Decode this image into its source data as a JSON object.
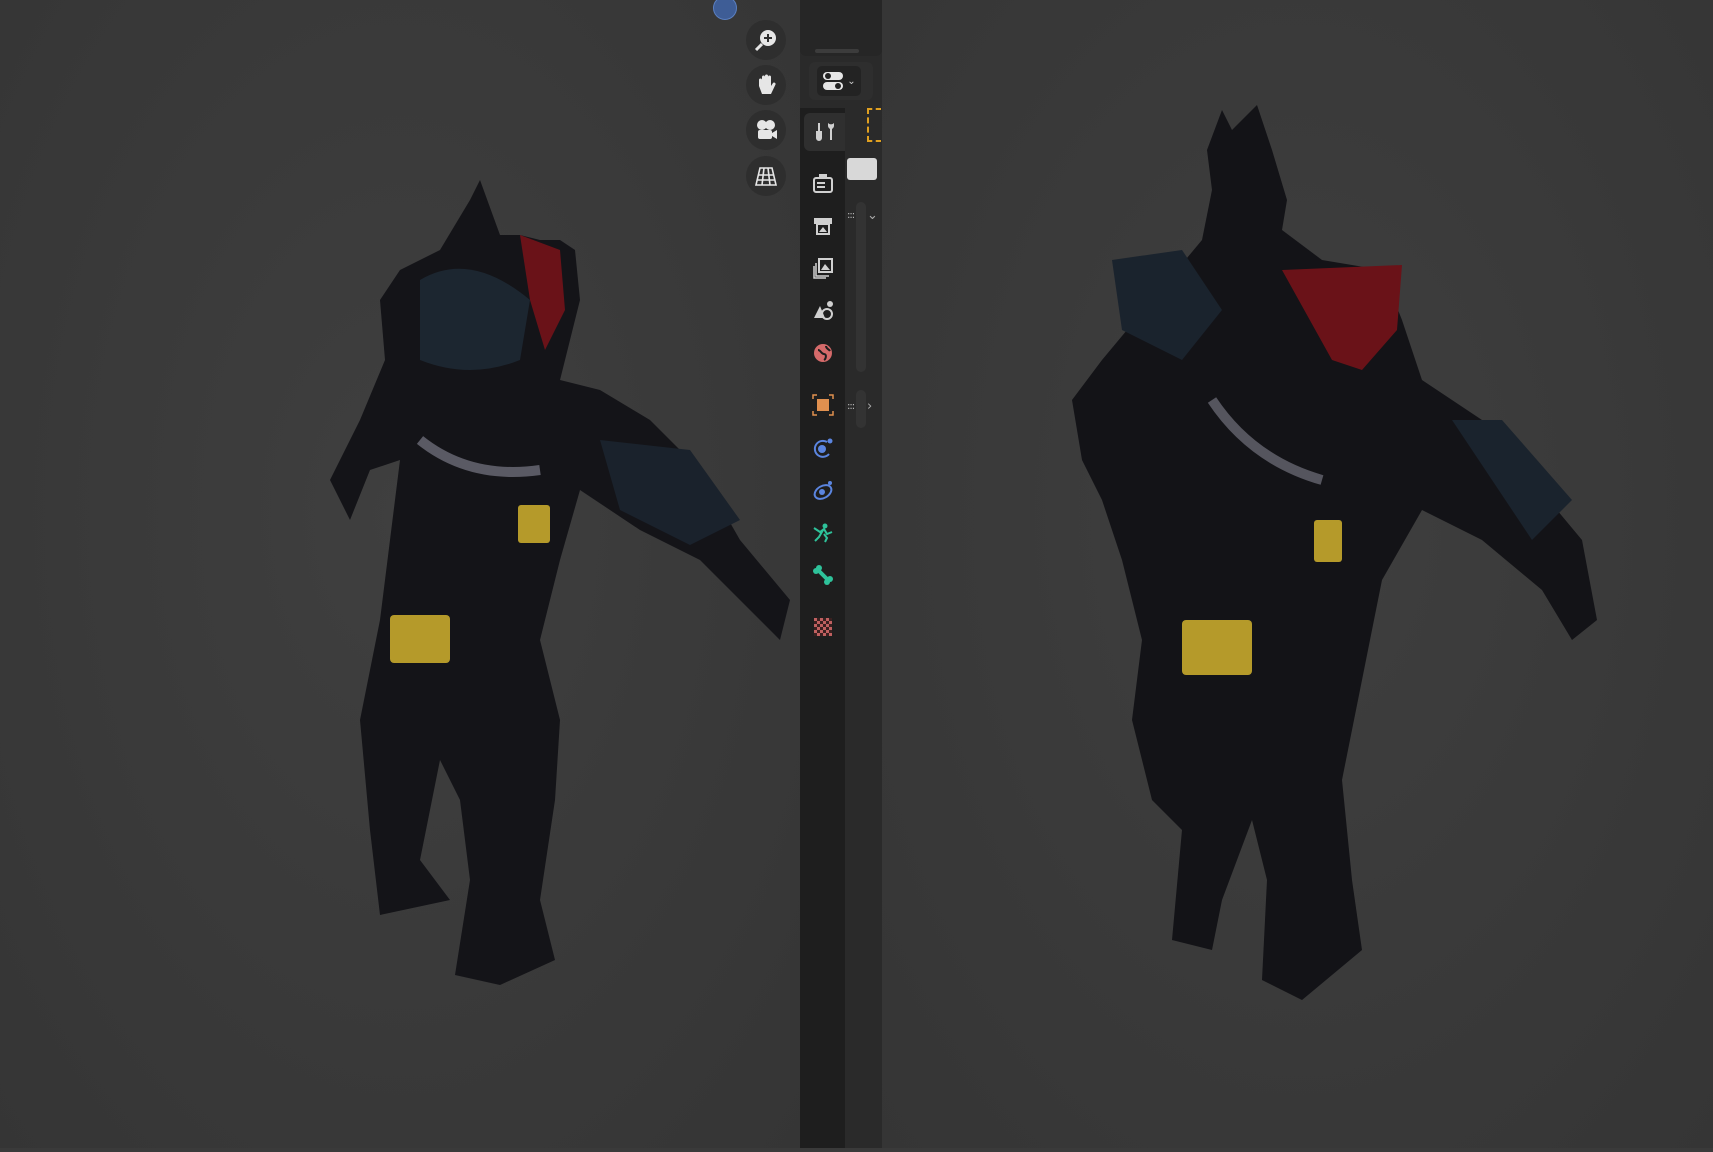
{
  "viewport_left": {
    "name": "3d-viewport",
    "navigation": [
      "zoom-icon",
      "pan-hand-icon",
      "camera-view-icon",
      "ortho-grid-icon"
    ]
  },
  "viewport_right": {
    "name": "3d-viewport"
  },
  "properties": {
    "editor_type_icon": "properties-toggle-icon",
    "tabs": [
      {
        "name": "tool",
        "color": "#d0d0d0"
      },
      {
        "name": "render",
        "color": "#d0d0d0"
      },
      {
        "name": "output",
        "color": "#d0d0d0"
      },
      {
        "name": "view-layer",
        "color": "#d0d0d0"
      },
      {
        "name": "scene",
        "color": "#d0d0d0"
      },
      {
        "name": "world",
        "color": "#d56a6a"
      },
      {
        "name": "object",
        "color": "#e0904f"
      },
      {
        "name": "modifiers",
        "color": "#5b85e0"
      },
      {
        "name": "particles",
        "color": "#5b85e0"
      },
      {
        "name": "physics",
        "color": "#2ec29a"
      },
      {
        "name": "object-data-bone",
        "color": "#2ec29a"
      },
      {
        "name": "texture",
        "color": "#c06060"
      }
    ],
    "active_tab": "tool"
  }
}
